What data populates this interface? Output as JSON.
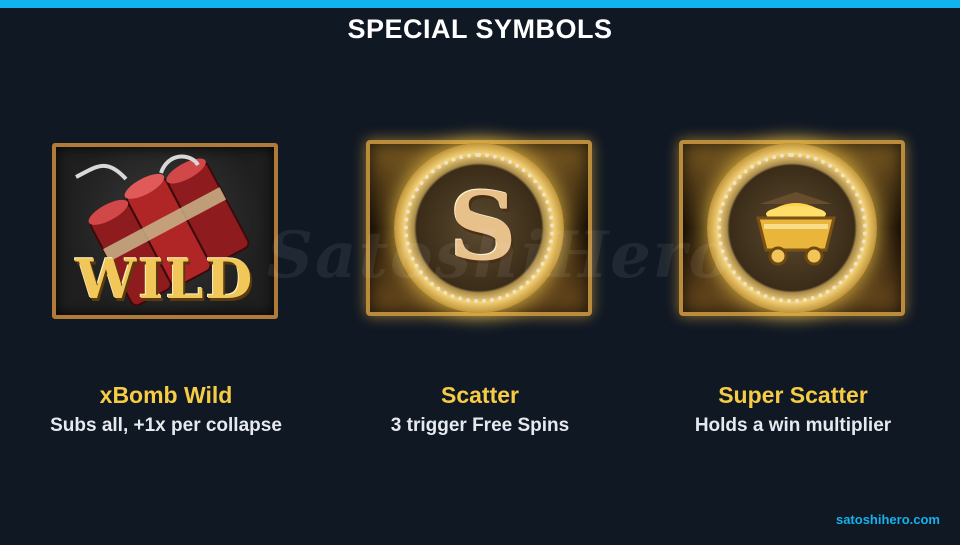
{
  "header": {
    "title": "SPECIAL SYMBOLS"
  },
  "watermark": "SatoshiHero",
  "symbols": [
    {
      "name": "xBomb Wild",
      "desc": "Subs all, +1x per collapse",
      "art_label": "WILD",
      "icon": "dynamite-icon"
    },
    {
      "name": "Scatter",
      "desc": "3 trigger Free Spins",
      "art_label": "S",
      "icon": "scatter-coin-icon"
    },
    {
      "name": "Super Scatter",
      "desc": "Holds a win multiplier",
      "icon": "mine-cart-coin-icon"
    }
  ],
  "footer": {
    "site": "satoshihero.com"
  },
  "colors": {
    "accent_bar": "#12b4ee",
    "background": "#101824",
    "name_gold": "#f6cc45",
    "site_blue": "#14b2ec"
  }
}
